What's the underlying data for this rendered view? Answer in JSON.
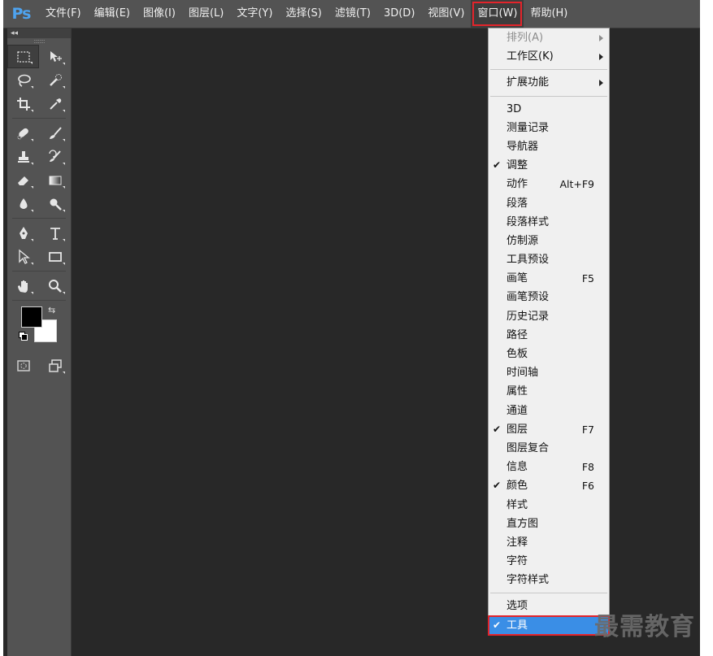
{
  "app": {
    "logo": "Ps"
  },
  "menubar": [
    {
      "label": "文件(F)"
    },
    {
      "label": "编辑(E)"
    },
    {
      "label": "图像(I)"
    },
    {
      "label": "图层(L)"
    },
    {
      "label": "文字(Y)"
    },
    {
      "label": "选择(S)"
    },
    {
      "label": "滤镜(T)"
    },
    {
      "label": "3D(D)"
    },
    {
      "label": "视图(V)"
    },
    {
      "label": "窗口(W)",
      "active": true
    },
    {
      "label": "帮助(H)"
    }
  ],
  "toolbar": {
    "collapse_glyph": "◂◂",
    "grip": "::::::::",
    "swap_glyph": "⇆",
    "tools": [
      [
        "rectangular-marquee-icon",
        "move-icon"
      ],
      [
        "lasso-icon",
        "quick-selection-icon"
      ],
      [
        "crop-icon",
        "eyedropper-icon"
      ],
      [
        "spot-healing-icon",
        "brush-icon"
      ],
      [
        "clone-stamp-icon",
        "history-brush-icon"
      ],
      [
        "eraser-icon",
        "gradient-icon"
      ],
      [
        "blur-icon",
        "dodge-icon"
      ],
      [
        "pen-icon",
        "type-icon"
      ],
      [
        "path-selection-icon",
        "rectangle-shape-icon"
      ],
      [
        "hand-icon",
        "zoom-icon"
      ]
    ],
    "foreground_color": "#000000",
    "background_color": "#ffffff"
  },
  "window_menu": {
    "items": [
      {
        "label": "排列(A)",
        "submenu": true,
        "disabled": true
      },
      {
        "label": "工作区(K)",
        "submenu": true
      },
      {
        "sep": true
      },
      {
        "label": "扩展功能",
        "submenu": true
      },
      {
        "sep": true
      },
      {
        "label": "3D"
      },
      {
        "label": "测量记录"
      },
      {
        "label": "导航器"
      },
      {
        "label": "调整",
        "checked": true
      },
      {
        "label": "动作",
        "shortcut": "Alt+F9"
      },
      {
        "label": "段落"
      },
      {
        "label": "段落样式"
      },
      {
        "label": "仿制源"
      },
      {
        "label": "工具预设"
      },
      {
        "label": "画笔",
        "shortcut": "F5"
      },
      {
        "label": "画笔预设"
      },
      {
        "label": "历史记录"
      },
      {
        "label": "路径"
      },
      {
        "label": "色板"
      },
      {
        "label": "时间轴"
      },
      {
        "label": "属性"
      },
      {
        "label": "通道"
      },
      {
        "label": "图层",
        "checked": true,
        "shortcut": "F7"
      },
      {
        "label": "图层复合"
      },
      {
        "label": "信息",
        "shortcut": "F8"
      },
      {
        "label": "颜色",
        "checked": true,
        "shortcut": "F6"
      },
      {
        "label": "样式"
      },
      {
        "label": "直方图"
      },
      {
        "label": "注释"
      },
      {
        "label": "字符"
      },
      {
        "label": "字符样式"
      },
      {
        "sep": true
      },
      {
        "label": "选项"
      },
      {
        "label": "工具",
        "checked": true,
        "highlight": true
      }
    ],
    "check_glyph": "✔"
  },
  "watermark": "最需教育",
  "colors": {
    "accent_highlight": "#3a8ee6",
    "annotation_red": "#e3242b",
    "logo_blue": "#4ea3ef"
  }
}
